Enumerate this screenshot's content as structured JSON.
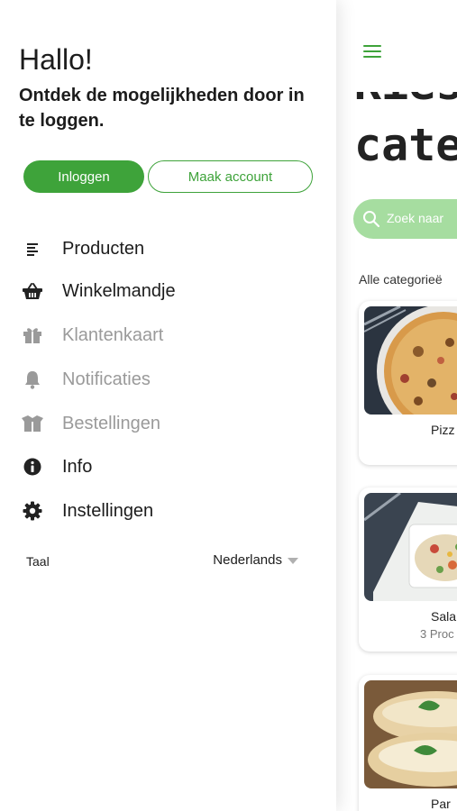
{
  "drawer": {
    "greeting": "Hallo!",
    "subtitle": "Ontdek de mogelijkheden door in te loggen.",
    "login_button": "Inloggen",
    "create_account_button": "Maak account",
    "menu": [
      {
        "label": "Producten",
        "icon": "list-icon",
        "enabled": true
      },
      {
        "label": "Winkelmandje",
        "icon": "basket-icon",
        "enabled": true
      },
      {
        "label": "Klantenkaart",
        "icon": "gift-icon",
        "enabled": false
      },
      {
        "label": "Notificaties",
        "icon": "bell-icon",
        "enabled": false
      },
      {
        "label": "Bestellingen",
        "icon": "box-icon",
        "enabled": false
      },
      {
        "label": "Info",
        "icon": "info-icon",
        "enabled": true
      },
      {
        "label": "Instellingen",
        "icon": "gear-icon",
        "enabled": true
      }
    ],
    "language": {
      "label": "Taal",
      "value": "Nederlands"
    }
  },
  "main": {
    "title_partial": "Kies",
    "title": "cate",
    "search_placeholder": "Zoek naar",
    "categories_label": "Alle categorieë",
    "categories": [
      {
        "name": "Pizz",
        "count": ""
      },
      {
        "name": "Sala",
        "count": "3 Proc"
      },
      {
        "name": "Par",
        "count": ""
      }
    ]
  },
  "colors": {
    "accent": "#3ea33a",
    "search_bg": "#a6dda0",
    "disabled_text": "#9a9a9a"
  }
}
